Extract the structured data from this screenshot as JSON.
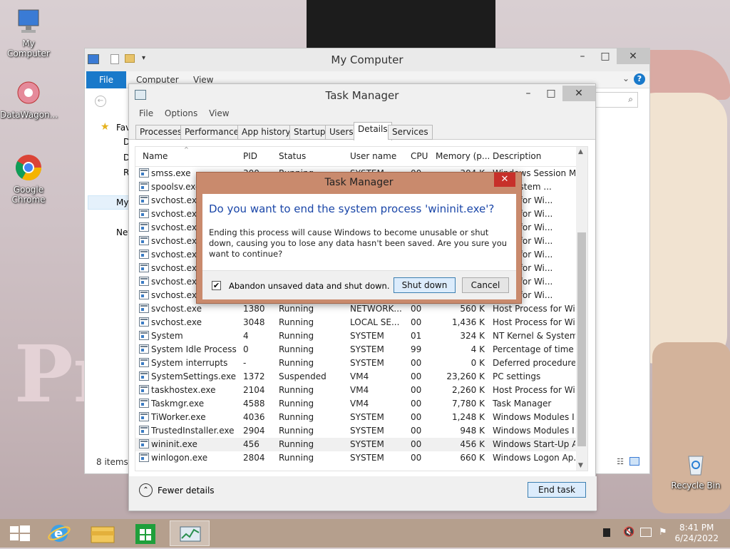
{
  "desktop": {
    "icons": [
      {
        "label": "My Computer"
      },
      {
        "label": "DataWagon..."
      },
      {
        "label": "Google Chrome"
      },
      {
        "label": "Recycle Bin"
      }
    ]
  },
  "explorer": {
    "title": "My Computer",
    "file_tab": "File",
    "ribbon_tabs": [
      "Computer",
      "View"
    ],
    "nav_items": [
      "Fav",
      "D",
      "D",
      "R",
      "My",
      "Net"
    ],
    "status": "8 items"
  },
  "taskmanager": {
    "title": "Task Manager",
    "menu": [
      "File",
      "Options",
      "View"
    ],
    "tabs": [
      "Processes",
      "Performance",
      "App history",
      "Startup",
      "Users",
      "Details",
      "Services"
    ],
    "active_tab": "Details",
    "columns": [
      "Name",
      "PID",
      "Status",
      "User name",
      "CPU",
      "Memory (p...",
      "Description"
    ],
    "rows": [
      {
        "name": "smss.exe",
        "pid": "300",
        "status": "Running",
        "user": "SYSTEM",
        "cpu": "00",
        "mem": "304 K",
        "desc": "Windows Session M..."
      },
      {
        "name": "spoolsv.exe",
        "pid": "",
        "status": "",
        "user": "",
        "cpu": "",
        "mem": "",
        "desc": "SubSystem ..."
      },
      {
        "name": "svchost.exe",
        "pid": "",
        "status": "",
        "user": "",
        "cpu": "",
        "mem": "",
        "desc": "ocess for Wi..."
      },
      {
        "name": "svchost.exe",
        "pid": "",
        "status": "",
        "user": "",
        "cpu": "",
        "mem": "",
        "desc": "ocess for Wi..."
      },
      {
        "name": "svchost.exe",
        "pid": "",
        "status": "",
        "user": "",
        "cpu": "",
        "mem": "",
        "desc": "ocess for Wi..."
      },
      {
        "name": "svchost.exe",
        "pid": "",
        "status": "",
        "user": "",
        "cpu": "",
        "mem": "",
        "desc": "ocess for Wi..."
      },
      {
        "name": "svchost.exe",
        "pid": "",
        "status": "",
        "user": "",
        "cpu": "",
        "mem": "",
        "desc": "ocess for Wi..."
      },
      {
        "name": "svchost.exe",
        "pid": "",
        "status": "",
        "user": "",
        "cpu": "",
        "mem": "",
        "desc": "ocess for Wi..."
      },
      {
        "name": "svchost.exe",
        "pid": "",
        "status": "",
        "user": "",
        "cpu": "",
        "mem": "",
        "desc": "ocess for Wi..."
      },
      {
        "name": "svchost.exe",
        "pid": "",
        "status": "",
        "user": "",
        "cpu": "",
        "mem": "",
        "desc": "ocess for Wi..."
      },
      {
        "name": "svchost.exe",
        "pid": "1380",
        "status": "Running",
        "user": "NETWORK...",
        "cpu": "00",
        "mem": "560 K",
        "desc": "Host Process for Wi..."
      },
      {
        "name": "svchost.exe",
        "pid": "3048",
        "status": "Running",
        "user": "LOCAL SE...",
        "cpu": "00",
        "mem": "1,436 K",
        "desc": "Host Process for Wi..."
      },
      {
        "name": "System",
        "pid": "4",
        "status": "Running",
        "user": "SYSTEM",
        "cpu": "01",
        "mem": "324 K",
        "desc": "NT Kernel & System"
      },
      {
        "name": "System Idle Process",
        "pid": "0",
        "status": "Running",
        "user": "SYSTEM",
        "cpu": "99",
        "mem": "4 K",
        "desc": "Percentage of time t..."
      },
      {
        "name": "System interrupts",
        "pid": "-",
        "status": "Running",
        "user": "SYSTEM",
        "cpu": "00",
        "mem": "0 K",
        "desc": "Deferred procedure ..."
      },
      {
        "name": "SystemSettings.exe",
        "pid": "1372",
        "status": "Suspended",
        "user": "VM4",
        "cpu": "00",
        "mem": "23,260 K",
        "desc": "PC settings"
      },
      {
        "name": "taskhostex.exe",
        "pid": "2104",
        "status": "Running",
        "user": "VM4",
        "cpu": "00",
        "mem": "2,260 K",
        "desc": "Host Process for Wi..."
      },
      {
        "name": "Taskmgr.exe",
        "pid": "4588",
        "status": "Running",
        "user": "VM4",
        "cpu": "00",
        "mem": "7,780 K",
        "desc": "Task Manager"
      },
      {
        "name": "TiWorker.exe",
        "pid": "4036",
        "status": "Running",
        "user": "SYSTEM",
        "cpu": "00",
        "mem": "1,248 K",
        "desc": "Windows Modules I..."
      },
      {
        "name": "TrustedInstaller.exe",
        "pid": "2904",
        "status": "Running",
        "user": "SYSTEM",
        "cpu": "00",
        "mem": "948 K",
        "desc": "Windows Modules I..."
      },
      {
        "name": "wininit.exe",
        "pid": "456",
        "status": "Running",
        "user": "SYSTEM",
        "cpu": "00",
        "mem": "456 K",
        "desc": "Windows Start-Up A..."
      },
      {
        "name": "winlogon.exe",
        "pid": "2804",
        "status": "Running",
        "user": "SYSTEM",
        "cpu": "00",
        "mem": "660 K",
        "desc": "Windows Logon Ap..."
      }
    ],
    "selected_row": "wininit.exe",
    "fewer_details": "Fewer details",
    "end_task": "End task"
  },
  "dialog": {
    "title": "Task Manager",
    "close": "✕",
    "heading": "Do you want to end the system process 'wininit.exe'?",
    "message": "Ending this process will cause Windows to become unusable or shut down, causing you to lose any data hasn't been saved. Are you sure you want to continue?",
    "checkbox_label": "Abandon unsaved data and shut down.",
    "checkbox_checked": true,
    "shutdown": "Shut down",
    "cancel": "Cancel"
  },
  "taskbar": {
    "time": "8:41 PM",
    "date": "6/24/2022"
  },
  "colors": {
    "accent": "#1979ca",
    "dialog_frame": "#c98a6d",
    "close_red": "#c7302a",
    "taskbar": "#b59f8d"
  }
}
